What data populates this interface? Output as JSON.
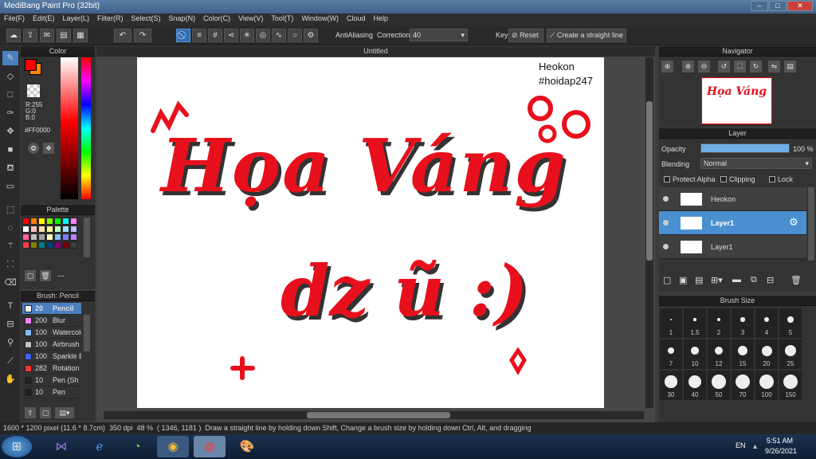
{
  "title_bar": {
    "title": "MediBang Paint Pro (32bit)"
  },
  "menu": [
    "File(F)",
    "Edit(E)",
    "Layer(L)",
    "Filter(R)",
    "Select(S)",
    "Snap(N)",
    "Color(C)",
    "View(V)",
    "Tool(T)",
    "Window(W)",
    "Cloud",
    "Help"
  ],
  "toolbar": {
    "antialiasing": "AntiAliasing",
    "correction_label": "Correction",
    "correction_value": "40",
    "key_label": "Key",
    "reset_label": "Reset",
    "straight_line_label": "Create a straight line"
  },
  "color_panel": {
    "title": "Color",
    "r": "R:255",
    "g": "G:0",
    "b": "B:0",
    "hex": "#FF0000",
    "main_color": "#ff0000",
    "sub_color": "#ff8c00"
  },
  "palette_panel": {
    "title": "Palette",
    "menu_label": "---"
  },
  "palette_colors": [
    "#ff0000",
    "#ff8000",
    "#ffff00",
    "#80ff00",
    "#00ff00",
    "#00ffff",
    "#ff80ff",
    "#ffffff",
    "#ffc0c0",
    "#ffe0a0",
    "#ffffa0",
    "#c0ffc0",
    "#a0e0ff",
    "#c0c0ff",
    "#ff60a0",
    "#c0c0c0",
    "#a0a0a0",
    "#ffffc0",
    "#80c0ff",
    "#8080ff",
    "#c080ff",
    "#ff4040",
    "#808000",
    "#008080",
    "#004080",
    "#800080",
    "#800000",
    "#404040"
  ],
  "brush_panel": {
    "title": "Brush: Pencil",
    "items": [
      {
        "size": "20",
        "name": "Pencil",
        "color": "#ffffff"
      },
      {
        "size": "200",
        "name": "Blur",
        "color": "#ff80ff"
      },
      {
        "size": "100",
        "name": "Watercolor",
        "color": "#80c0ff"
      },
      {
        "size": "100",
        "name": "Airbrush",
        "color": "#c0c0c0"
      },
      {
        "size": "100",
        "name": "Sparkle B",
        "color": "#4060ff"
      },
      {
        "size": "282",
        "name": "Rotation",
        "color": "#ff3030"
      },
      {
        "size": "10",
        "name": "Pen (Sh",
        "color": "#202020"
      },
      {
        "size": "10",
        "name": "Pen",
        "color": "#202020"
      }
    ]
  },
  "document": {
    "tab_title": "Untitled",
    "watermark_line1": "Heokon",
    "watermark_line2": "#hoidap247",
    "art_line1": "Họa Váng",
    "art_line2": "dz ũ :)",
    "art_color": "#e8101c"
  },
  "navigator": {
    "title": "Navigator"
  },
  "layer_panel": {
    "title": "Layer",
    "opacity_label": "Opacity",
    "opacity_value": "100 %",
    "opacity_fraction": 1.0,
    "blending_label": "Blending",
    "blending_value": "Normal",
    "protect_alpha": "Protect Alpha",
    "clipping": "Clipping",
    "lock": "Lock",
    "layers": [
      {
        "name": "Heokon"
      },
      {
        "name": "Layer1"
      },
      {
        "name": "Layer1"
      }
    ]
  },
  "brush_size_panel": {
    "title": "Brush Size",
    "sizes": [
      "1",
      "1.5",
      "2",
      "3",
      "4",
      "5",
      "7",
      "10",
      "12",
      "15",
      "20",
      "25",
      "30",
      "40",
      "50",
      "70",
      "100",
      "150"
    ]
  },
  "status_bar": {
    "dimensions": "1600 * 1200 pixel",
    "physical": "(11.6 * 8.7cm)",
    "dpi": "350 dpi",
    "zoom": "48 %",
    "coords": "( 1346, 1181 )",
    "hint": "Draw a straight line by holding down Shift, Change a brush size by holding down Ctrl, Alt, and dragging"
  },
  "taskbar": {
    "lang": "EN",
    "time": "5:51 AM",
    "date": "9/26/2021"
  }
}
